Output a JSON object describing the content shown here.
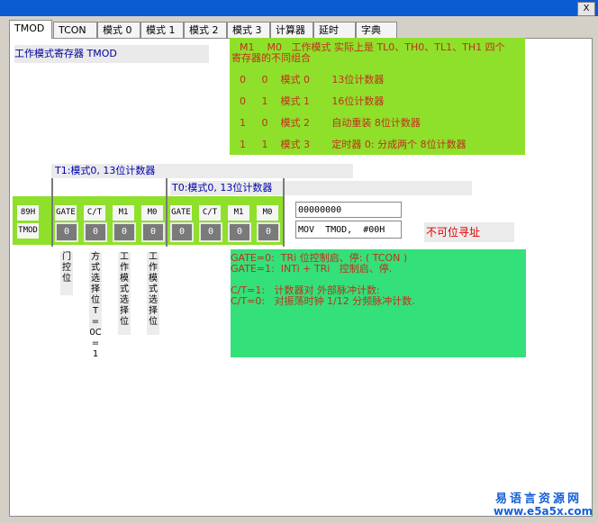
{
  "window": {
    "close_label": "X"
  },
  "tabs": [
    "TMOD",
    "TCON",
    "模式 0",
    "模式 1",
    "模式 2",
    "模式 3",
    "计算器",
    "延时",
    "字典"
  ],
  "title_label": "工作模式寄存器 TMOD",
  "mode_table": {
    "header": "M1    M0   工作模式 实际上是 TL0、TH0、TL1、TH1 四个",
    "header2": "寄存器的不同组合",
    "rows": [
      "0     0    模式 0       13位计数器",
      "0     1    模式 1       16位计数器",
      "1     0    模式 2       自动重装 8位计数器",
      "1     1    模式 3       定时器 0: 分成两个 8位计数器"
    ]
  },
  "t1_label": "T1:模式0, 13位计数器",
  "t0_label": "T0:模式0, 13位计数器",
  "reg_addr": "89H",
  "reg_name": "TMOD",
  "bit_labels": [
    "GATE",
    "C/T",
    "M1",
    "M0",
    "GATE",
    "C/T",
    "M1",
    "M0"
  ],
  "bit_values": [
    "0",
    "0",
    "0",
    "0",
    "0",
    "0",
    "0",
    "0"
  ],
  "binary_value": "00000000",
  "asm_value": "MOV  TMOD,  #00H",
  "not_bit_addressable": "不可位寻址",
  "vertical_labels": [
    "门控位",
    "方式选择位T=0C=1",
    "工作模式选择位",
    "工作模式选择位"
  ],
  "desc": {
    "line1": "GATE=0:  TRi 位控制启、停: ( TCON )",
    "line2": "GATE=1:  INTi + TRi   控制启、停.",
    "line3": "C/T=1:   计数器对 外部脉冲计数:",
    "line4": "C/T=0:   对振荡时钟 1/12 分频脉冲计数."
  },
  "watermark": {
    "line1": "易语言资源网",
    "line2": "www.e5a5x.com"
  },
  "colors": {
    "green_panel": "#8fe02a",
    "teal_panel": "#34e07a",
    "title_blue": "#0a5ad2",
    "red_text": "#c0301c"
  }
}
